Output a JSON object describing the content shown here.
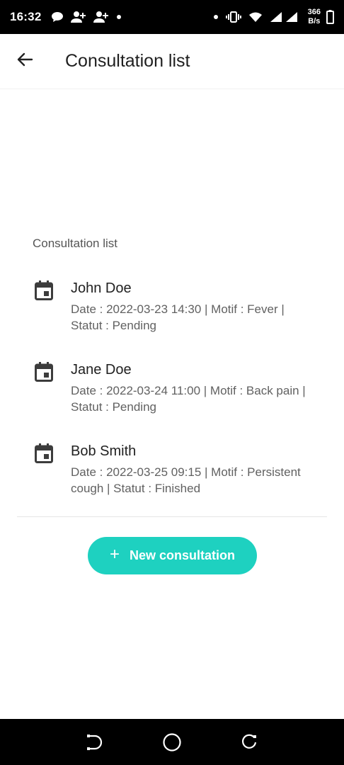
{
  "status_bar": {
    "time": "16:32",
    "icons_left": [
      "chat-bubble-icon",
      "person-add-icon",
      "person-add-icon",
      "dot-icon"
    ],
    "icons_right": [
      "dot-icon",
      "vibrate-icon",
      "wifi-icon",
      "signal-icon",
      "signal-icon",
      "battery-icon"
    ],
    "net_speed_value": "366",
    "net_speed_unit": "B/s"
  },
  "app_bar": {
    "back_icon": "arrow-back-icon",
    "title": "Consultation list"
  },
  "main": {
    "section_label": "Consultation list",
    "consultations": [
      {
        "icon": "calendar-icon",
        "name": "John Doe",
        "detail": "Date : 2022-03-23 14:30 | Motif : Fever | Statut : Pending"
      },
      {
        "icon": "calendar-icon",
        "name": "Jane Doe",
        "detail": "Date : 2022-03-24 11:00 | Motif : Back pain | Statut : Pending"
      },
      {
        "icon": "calendar-icon",
        "name": "Bob Smith",
        "detail": "Date : 2022-03-25 09:15 | Motif : Persistent cough | Statut : Finished"
      }
    ],
    "new_button": {
      "icon": "plus-icon",
      "label": "New consultation"
    }
  },
  "nav_bar": {
    "buttons": [
      "back-nav-icon",
      "home-nav-icon",
      "recents-nav-icon"
    ]
  },
  "colors": {
    "accent": "#1ed1c0",
    "status_bar_bg": "#000000",
    "text_primary": "#212121",
    "text_secondary": "#616161"
  }
}
